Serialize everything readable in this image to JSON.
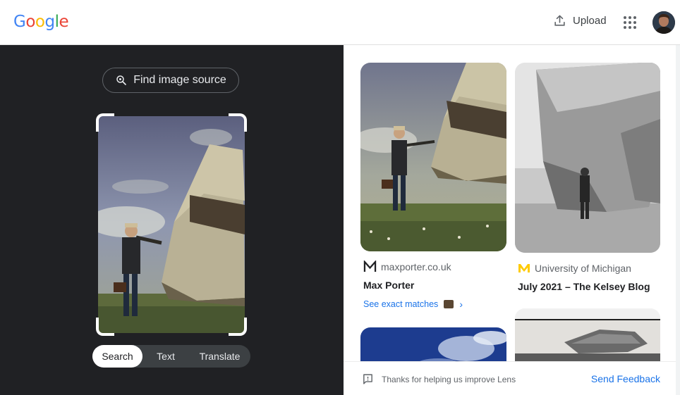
{
  "header": {
    "logo_letters": [
      {
        "char": "G",
        "color": "#4285F4"
      },
      {
        "char": "o",
        "color": "#EA4335"
      },
      {
        "char": "o",
        "color": "#FBBC05"
      },
      {
        "char": "g",
        "color": "#4285F4"
      },
      {
        "char": "l",
        "color": "#34A853"
      },
      {
        "char": "e",
        "color": "#EA4335"
      }
    ],
    "upload_label": "Upload",
    "upload_icon": "upload-icon",
    "apps_icon": "apps-grid-icon"
  },
  "left_panel": {
    "find_source_label": "Find image source",
    "find_source_icon": "lens-search-icon",
    "modes": [
      {
        "label": "Search",
        "active": true
      },
      {
        "label": "Text",
        "active": false
      },
      {
        "label": "Translate",
        "active": false
      }
    ]
  },
  "results": [
    {
      "source_name": "maxporter.co.uk",
      "source_icon": "maxporter-m-logo-icon",
      "title": "Max Porter",
      "exact_matches_label": "See exact matches"
    },
    {
      "source_name": "University of Michigan",
      "source_icon": "michigan-m-logo-icon",
      "title": "July 2021 – The Kelsey Blog"
    }
  ],
  "feedback": {
    "text": "Thanks for helping us improve Lens",
    "send_label": "Send Feedback"
  },
  "colors": {
    "left_panel_bg": "#202124",
    "link_blue": "#1a73e8",
    "michigan_gold": "#FFCB05"
  }
}
